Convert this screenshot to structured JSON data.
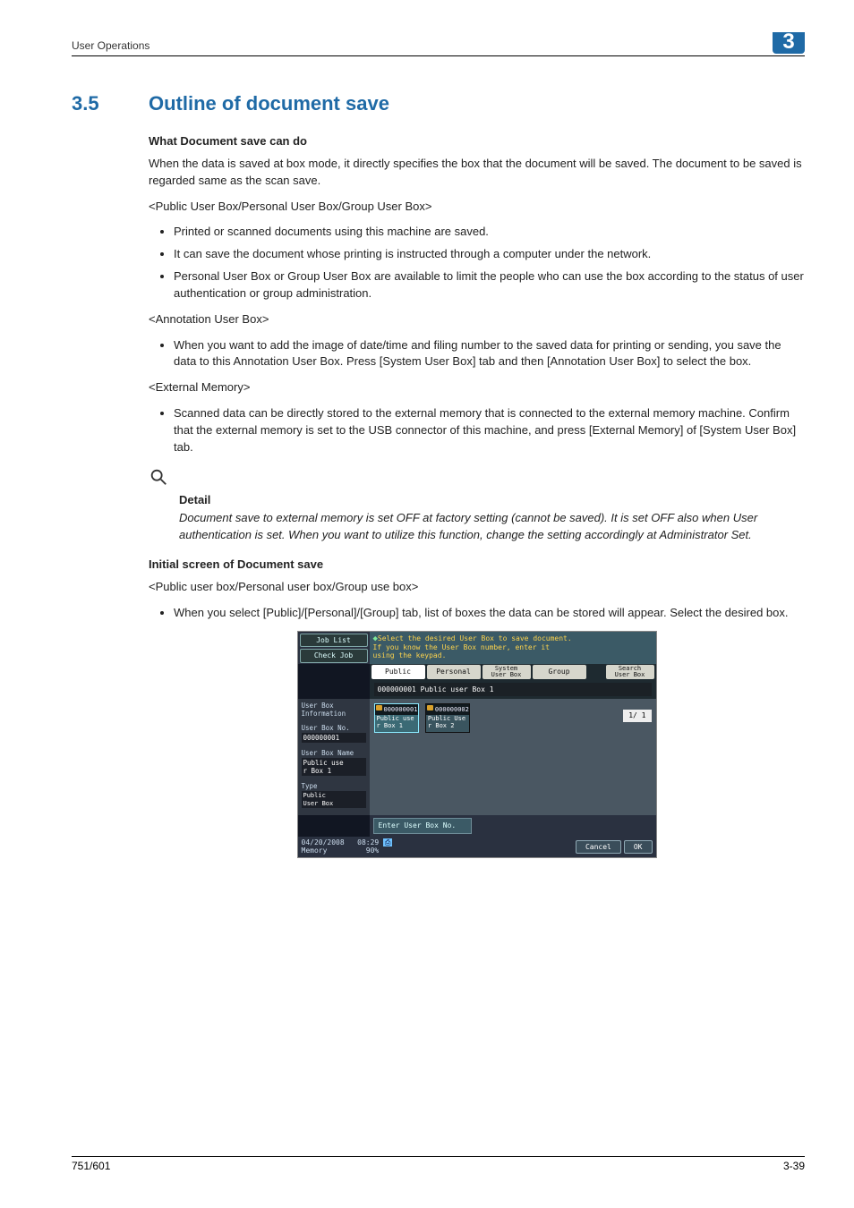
{
  "header": {
    "title": "User Operations",
    "chapter_num": "3"
  },
  "section": {
    "number": "3.5",
    "title": "Outline of document save"
  },
  "body": {
    "h_what": "What Document save can do",
    "p_intro": "When the data is saved at box mode, it directly specifies the box that the document will be saved. The document to be saved is regarded same as the scan save.",
    "sub1": "<Public User Box/Personal User Box/Group User Box>",
    "sub1_items": {
      "0": "Printed or scanned documents using this machine are saved.",
      "1": "It can save the document whose printing is instructed through a computer under the network.",
      "2": "Personal User Box or Group User Box are available to limit the people who can use the box according to the status of user authentication or group administration."
    },
    "sub2": "<Annotation User Box>",
    "sub2_items": {
      "0": "When you want to add the image of date/time and filing number to the saved data for printing or sending, you save the data to this Annotation User Box. Press [System User Box] tab and then [Annotation User Box] to select the box."
    },
    "sub3": "<External Memory>",
    "sub3_items": {
      "0": "Scanned data can be directly stored to the external memory that is connected to the external memory machine. Confirm that the external memory is set to the USB connector of this machine, and press [External Memory] of [System User Box] tab."
    },
    "detail_label": "Detail",
    "detail_body": "Document save to external memory is set OFF at factory setting (cannot be saved). It is set OFF also when User authentication is set. When you want to utilize this function, change the setting accordingly at Administrator Set.",
    "h_initial": "Initial screen of Document save",
    "initial_sub": "<Public user box/Personal user box/Group use box>",
    "initial_items": {
      "0": "When you select [Public]/[Personal]/[Group] tab, list of boxes the data can be stored will appear. Select the desired box."
    }
  },
  "scr": {
    "job_list": "Job List",
    "check_job": "Check Job",
    "hint1": "Select the desired User Box to save document.",
    "hint2": "If you know the User Box number, enter it",
    "hint3": "using the keypad.",
    "tabs": {
      "public": "Public",
      "personal": "Personal",
      "system": "System\nUser Box",
      "group": "Group",
      "search": "Search\nUser Box"
    },
    "selected_row": "000000001   Public user Box 1",
    "side": {
      "heading": "User Box\nInformation",
      "no_label": "User Box No.",
      "no_val": "000000001",
      "name_label": "User Box Name",
      "name_val": "Public use\nr Box 1",
      "type_label": "Type",
      "type_val": "Public\nUser Box"
    },
    "boxes": {
      "0": {
        "num": "000000001",
        "name": "Public use\nr Box 1"
      },
      "1": {
        "num": "000000002",
        "name": "Public Use\nr Box 2"
      }
    },
    "page_ind": "1/  1",
    "enter": "Enter User Box No.",
    "footer": {
      "date": "04/20/2008",
      "time": "08:29",
      "memlabel": "Memory",
      "mem": "90%",
      "cancel": "Cancel",
      "ok": "OK"
    }
  },
  "footer": {
    "left": "751/601",
    "right": "3-39"
  }
}
